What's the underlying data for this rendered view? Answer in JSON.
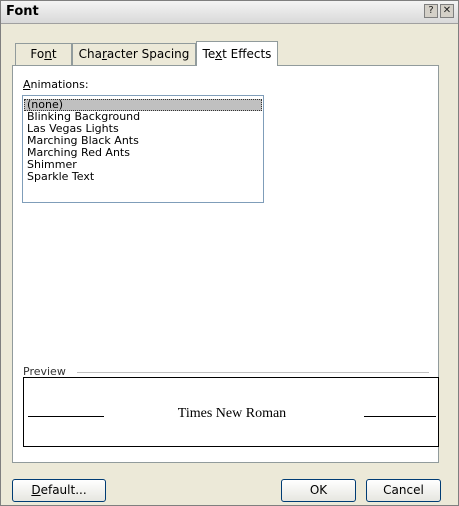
{
  "window": {
    "title": "Font",
    "help_glyph": "?",
    "close_glyph": "✕"
  },
  "tabs": [
    {
      "label": "Font",
      "accel": "n"
    },
    {
      "label": "Character Spacing",
      "accel": "r"
    },
    {
      "label": "Text Effects",
      "accel": "x",
      "active": true
    }
  ],
  "animations": {
    "label": "Animations:",
    "selected": "(none)",
    "items": [
      "(none)",
      "Blinking Background",
      "Las Vegas Lights",
      "Marching Black Ants",
      "Marching Red Ants",
      "Shimmer",
      "Sparkle Text"
    ]
  },
  "preview": {
    "label": "Preview",
    "sample_text": "Times New Roman"
  },
  "buttons": {
    "default": "Default...",
    "ok": "OK",
    "cancel": "Cancel"
  }
}
